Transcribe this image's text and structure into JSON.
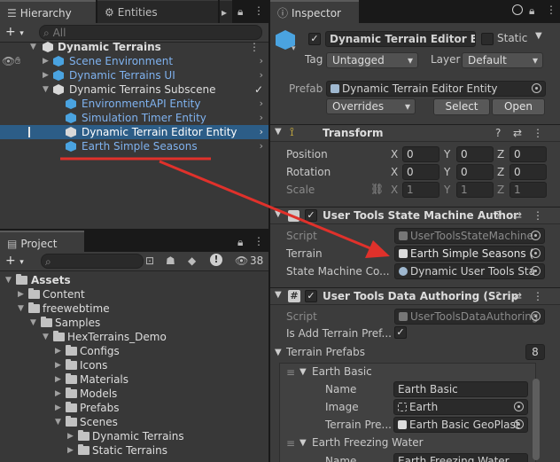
{
  "hierarchy": {
    "tab_hierarchy": "Hierarchy",
    "tab_entities": "Entities Hierarchy",
    "search_placeholder": "All",
    "rows": [
      {
        "label": "Dynamic Terrains"
      },
      {
        "label": "Scene Environment"
      },
      {
        "label": "Dynamic Terrains UI"
      },
      {
        "label": "Dynamic Terrains Subscene"
      },
      {
        "label": "EnvironmentAPI Entity"
      },
      {
        "label": "Simulation Timer Entity"
      },
      {
        "label": "Dynamic Terrain Editor Entity"
      },
      {
        "label": "Earth Simple Seasons"
      }
    ]
  },
  "project": {
    "tab": "Project",
    "count": "38",
    "tree": [
      {
        "label": "Assets"
      },
      {
        "label": "Content"
      },
      {
        "label": "freewebtime"
      },
      {
        "label": "Samples"
      },
      {
        "label": "HexTerrains_Demo"
      },
      {
        "label": "Configs"
      },
      {
        "label": "Icons"
      },
      {
        "label": "Materials"
      },
      {
        "label": "Models"
      },
      {
        "label": "Prefabs"
      },
      {
        "label": "Scenes"
      },
      {
        "label": "Dynamic Terrains"
      },
      {
        "label": "Static Terrains"
      }
    ]
  },
  "inspector": {
    "tab": "Inspector",
    "object_name": "Dynamic Terrain Editor E",
    "static_label": "Static",
    "tag_label": "Tag",
    "tag_value": "Untagged",
    "layer_label": "Layer",
    "layer_value": "Default",
    "prefab_label": "Prefab",
    "prefab_value": "Dynamic Terrain Editor Entity",
    "overrides": "Overrides",
    "select": "Select",
    "open": "Open",
    "transform": {
      "title": "Transform",
      "position_label": "Position",
      "rotation_label": "Rotation",
      "scale_label": "Scale",
      "x": "X",
      "y": "Y",
      "z": "Z",
      "position": [
        "0",
        "0",
        "0"
      ],
      "rotation": [
        "0",
        "0",
        "0"
      ],
      "scale": [
        "1",
        "1",
        "1"
      ]
    },
    "state_machine": {
      "title": "User Tools State Machine Author",
      "script_label": "Script",
      "script_value": "UserToolsStateMachine",
      "terrain_label": "Terrain",
      "terrain_value": "Earth Simple Seasons (",
      "smc_label": "State Machine Co...",
      "smc_value": "Dynamic User Tools Sta"
    },
    "data_authoring": {
      "title": "User Tools Data Authoring (Scrip",
      "script_label": "Script",
      "script_value": "UserToolsDataAuthoring",
      "add_terrain_label": "Is Add Terrain Pref...",
      "terrain_prefabs_label": "Terrain Prefabs",
      "terrain_prefabs_count": "8",
      "item1_title": "Earth Basic",
      "name_label": "Name",
      "item1_name": "Earth Basic",
      "image_label": "Image",
      "item1_image": "Earth",
      "terrain_pre_label": "Terrain Pre...",
      "item1_terrain": "Earth Basic GeoPlast",
      "item2_title": "Earth Freezing Water",
      "item2_name": "Earth Freezing Water"
    }
  },
  "colors": {
    "selection": "#2c5d87",
    "link_blue": "#7fb2ef",
    "annotation_red": "#e0312b"
  }
}
